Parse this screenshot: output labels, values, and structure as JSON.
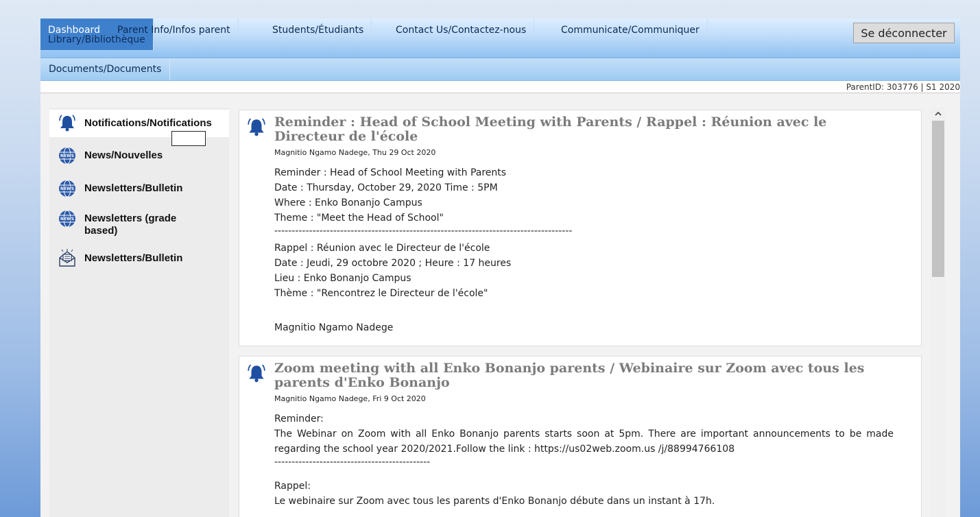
{
  "nav": {
    "primary": [
      {
        "label": "Dashboard",
        "sub": "Library/Bibliothèque",
        "active": true
      },
      {
        "label": "Parent Info/Infos parent"
      },
      {
        "label": "Students/Étudiants"
      },
      {
        "label": "Contact Us/Contactez-nous"
      },
      {
        "label": "Communicate/Communiquer"
      }
    ],
    "secondary": [
      {
        "label": "Documents/Documents"
      }
    ],
    "logout_label": "Se déconnecter"
  },
  "parent_id_text": "ParentID: 303776 | S1 2020",
  "sidebar": {
    "items": [
      {
        "label": "Notifications/Notifications",
        "icon": "bell-icon"
      },
      {
        "label": "News/Nouvelles",
        "icon": "news-globe-icon"
      },
      {
        "label": "Newsletters/Bulletin",
        "icon": "news-globe-icon"
      },
      {
        "label": "Newsletters (grade based)",
        "icon": "news-globe-icon"
      },
      {
        "label": "Newsletters/Bulletin",
        "icon": "envelope-open-icon"
      }
    ]
  },
  "notifications": [
    {
      "title": "Reminder : Head of School Meeting with Parents / Rappel : Réunion avec le Directeur de l'école",
      "meta": "Magnitio Ngamo Nadege, Thu 29 Oct 2020",
      "lines": [
        "Reminder : Head of School Meeting with Parents",
        "Date : Thursday, October 29, 2020 Time : 5PM",
        "Where : Enko Bonanjo Campus",
        "Theme : \"Meet the Head of School\"",
        "--------------------------------------------------------------------------------------",
        "Rappel : Réunion avec le Directeur de l'école",
        "Date : Jeudi, 29 octobre 2020 ; Heure : 17 heures",
        "Lieu : Enko Bonanjo Campus",
        "Thème : \"Rencontrez le Directeur de l'école\"",
        "",
        "Magnitio Ngamo Nadege"
      ]
    },
    {
      "title": "Zoom meeting with all Enko Bonanjo parents / Webinaire sur Zoom avec tous les parents d'Enko Bonanjo",
      "meta": "Magnitio Ngamo Nadege, Fri 9 Oct 2020",
      "lines": [
        "Reminder:",
        "The Webinar on Zoom with all Enko Bonanjo parents starts soon at 5pm. There are important announcements to be made regarding the school year 2020/2021.Follow the link : https://us02web.zoom.us /j/88994766108",
        "---------------------------------------------",
        "",
        "Rappel:",
        "Le webinaire sur Zoom avec tous les parents d'Enko Bonanjo débute dans un instant à 17h."
      ]
    }
  ]
}
